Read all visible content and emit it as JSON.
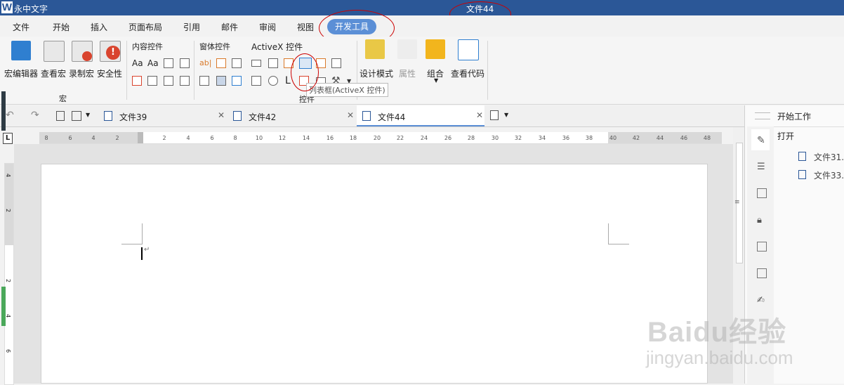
{
  "titlebar": {
    "app_name": "永中文字",
    "doc_title": "文件44"
  },
  "menu": {
    "tabs": [
      "文件",
      "开始",
      "插入",
      "页面布局",
      "引用",
      "邮件",
      "审阅",
      "视图",
      "开发工具"
    ],
    "active_tab": "开发工具"
  },
  "ribbon": {
    "macro_group": {
      "buttons": [
        "宏编辑器",
        "查看宏",
        "录制宏",
        "安全性"
      ],
      "label": "宏"
    },
    "content_controls_label": "内容控件",
    "form_controls_label": "窗体控件",
    "activex_label": "ActiveX 控件",
    "aa1": "Aa",
    "aa2": "Aa",
    "ab": "ab|",
    "l_glyph": "L",
    "design_mode": "设计模式",
    "properties": "属性",
    "group": "组合",
    "view_code": "查看代码",
    "controls_group_label": "控件",
    "tooltip": "列表框(ActiveX 控件)"
  },
  "doc_tabs": [
    "文件39",
    "文件42",
    "文件44"
  ],
  "active_doc": "文件44",
  "ruler": {
    "left_marks": [
      "8",
      "6",
      "4",
      "2"
    ],
    "right_marks": [
      "2",
      "4",
      "6",
      "8",
      "10",
      "12",
      "14",
      "16",
      "18",
      "20",
      "22",
      "24",
      "26",
      "28",
      "30",
      "32",
      "34",
      "36",
      "38",
      "40",
      "42",
      "44",
      "46",
      "48"
    ]
  },
  "vruler_marks": [
    "4",
    "2",
    "2",
    "4",
    "6"
  ],
  "cursor_mark": "↵",
  "right_pane": {
    "start_work": "开始工作",
    "open": "打开",
    "recent": [
      "文件31.",
      "文件33."
    ]
  },
  "watermark": {
    "brand": "Baidu经验",
    "url": "jingyan.baidu.com"
  },
  "colors": {
    "title_bar": "#2b5797",
    "active_tab": "#5b8fd6",
    "annotation": "#cc0000"
  }
}
